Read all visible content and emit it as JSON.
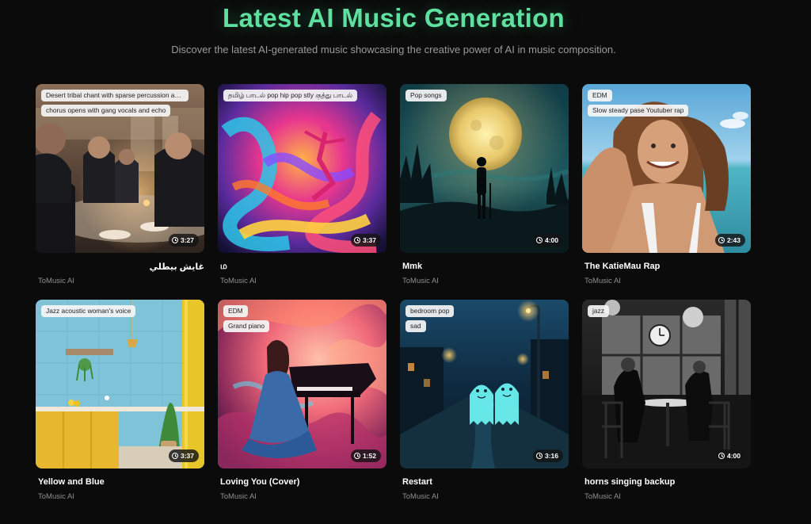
{
  "header": {
    "title": "Latest AI Music Generation",
    "subtitle": "Discover the latest AI-generated music showcasing the creative power of AI in music composition."
  },
  "cards": [
    {
      "title": "غايش بيطلي",
      "artist": "ToMusic AI",
      "duration": "3:27",
      "tags": [
        "Desert tribal chant with sparse percussion an...",
        "chorus opens with gang vocals and echo"
      ],
      "image": "dinner-scene"
    },
    {
      "title": "ம",
      "artist": "ToMusic AI",
      "duration": "3:37",
      "tags": [
        "தமிழ் பாடல் pop hip pop stly குத்து பாடல்"
      ],
      "image": "colorful-dancer"
    },
    {
      "title": "Mmk",
      "artist": "ToMusic AI",
      "duration": "4:00",
      "tags": [
        "Pop songs"
      ],
      "image": "moon-silhouette"
    },
    {
      "title": "The KatieMau Rap",
      "artist": "ToMusic AI",
      "duration": "2:43",
      "tags": [
        "EDM",
        "Slow steady pase Youtuber rap"
      ],
      "image": "beach-portrait"
    },
    {
      "title": "Yellow and Blue",
      "artist": "ToMusic AI",
      "duration": "3:37",
      "tags": [
        "Jazz acoustic woman's voice"
      ],
      "image": "yellow-blue-kitchen"
    },
    {
      "title": "Loving You (Cover)",
      "artist": "ToMusic AI",
      "duration": "1:52",
      "tags": [
        "EDM",
        "Grand piano"
      ],
      "image": "piano-woman"
    },
    {
      "title": "Restart",
      "artist": "ToMusic AI",
      "duration": "3:16",
      "tags": [
        "bedroom pop",
        "sad"
      ],
      "image": "ghost-street"
    },
    {
      "title": "horns singing backup",
      "artist": "ToMusic AI",
      "duration": "4:00",
      "tags": [
        "jazz"
      ],
      "image": "bw-cafe"
    }
  ]
}
